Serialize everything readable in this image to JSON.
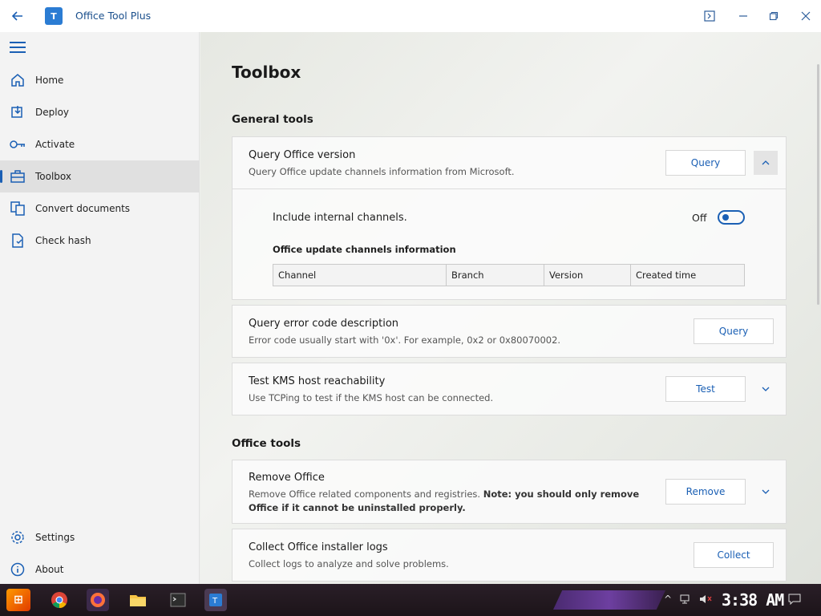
{
  "titlebar": {
    "app_title": "Office Tool Plus",
    "logo_text": "T",
    "icons": [
      "back-arrow-icon",
      "app-logo-icon",
      "terminal-icon",
      "minimize-icon",
      "restore-icon",
      "close-icon"
    ]
  },
  "sidebar": {
    "items": [
      {
        "label": "Home",
        "icon": "home-icon"
      },
      {
        "label": "Deploy",
        "icon": "deploy-icon"
      },
      {
        "label": "Activate",
        "icon": "key-icon"
      },
      {
        "label": "Toolbox",
        "icon": "toolbox-icon",
        "active": true
      },
      {
        "label": "Convert documents",
        "icon": "convert-icon"
      },
      {
        "label": "Check hash",
        "icon": "hash-icon"
      }
    ],
    "footer": [
      {
        "label": "Settings",
        "icon": "gear-icon"
      },
      {
        "label": "About",
        "icon": "info-icon"
      }
    ]
  },
  "main": {
    "page_title": "Toolbox",
    "general_tools_heading": "General tools",
    "office_tools_heading": "Office tools",
    "query_version": {
      "title": "Query Office version",
      "desc": "Query Office update channels information from Microsoft.",
      "button": "Query",
      "include_internal_label": "Include internal channels.",
      "toggle_state": "Off",
      "info_heading": "Office update channels information",
      "columns": [
        "Channel",
        "Branch",
        "Version",
        "Created time"
      ]
    },
    "error_code": {
      "title": "Query error code description",
      "desc": "Error code usually start with '0x'. For example, 0x2 or 0x80070002.",
      "button": "Query"
    },
    "kms": {
      "title": "Test KMS host reachability",
      "desc": "Use TCPing to test if the KMS host can be connected.",
      "button": "Test"
    },
    "remove_office": {
      "title": "Remove Office",
      "desc_prefix": "Remove Office related components and registries. ",
      "desc_bold": "Note: you should only remove Office if it cannot be uninstalled properly.",
      "button": "Remove"
    },
    "collect_logs": {
      "title": "Collect Office installer logs",
      "desc": "Collect logs to analyze and solve problems.",
      "button": "Collect"
    }
  },
  "taskbar": {
    "clock": "3:38 AM",
    "apps": [
      "start-icon",
      "chrome-icon",
      "firefox-icon",
      "file-explorer-icon",
      "terminal-app-icon",
      "office-tool-plus-icon"
    ]
  }
}
